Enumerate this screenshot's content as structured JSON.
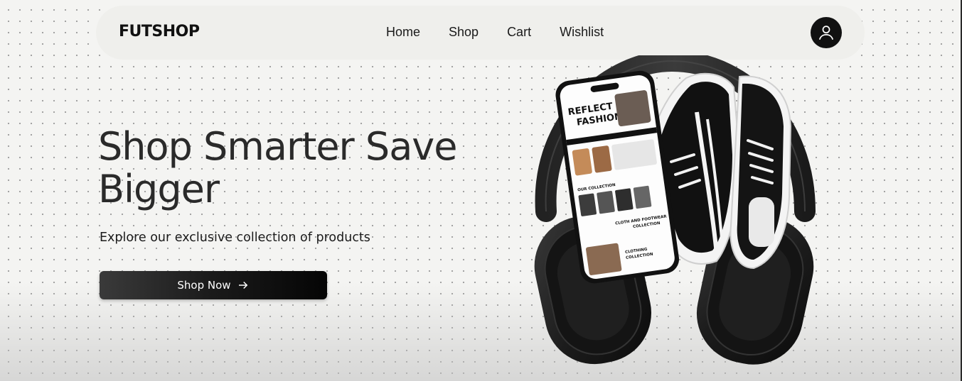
{
  "brand": "FUTSHOP",
  "nav": {
    "links": [
      "Home",
      "Shop",
      "Cart",
      "Wishlist"
    ]
  },
  "hero": {
    "title_line1": "Shop Smarter Save",
    "title_line2": "Bigger",
    "subtitle": "Explore our exclusive collection of products",
    "cta_label": "Shop Now"
  },
  "phone_screen": {
    "headline_1": "REFLECT",
    "headline_2": "FASHION",
    "section_1": "OUR COLLECTION",
    "section_2_line1": "CLOTH AND FOOTWEAR",
    "section_2_line2": "COLLECTION",
    "section_3_line1": "CLOTHING",
    "section_3_line2": "COLLECTION"
  },
  "colors": {
    "accent": "#111111",
    "navbar_bg": "#efefec",
    "page_bg": "#f4f4f2"
  },
  "icons": {
    "avatar": "user-icon",
    "cta": "arrow-right-icon"
  }
}
